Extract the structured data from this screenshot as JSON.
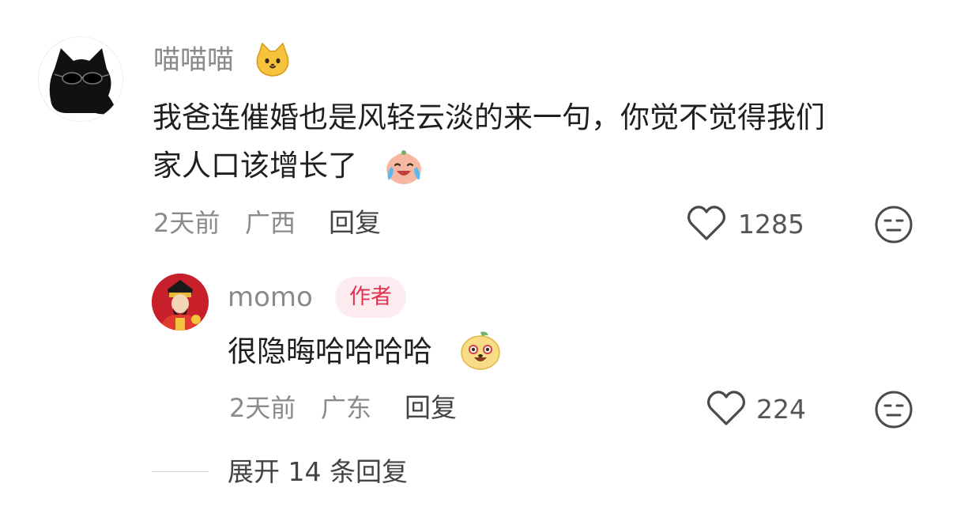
{
  "comment": {
    "username": "喵喵喵",
    "username_emoji": "cat-face-emoji",
    "text_line1": "我爸连催婚也是风轻云淡的来一句，你觉不觉得我们",
    "text_line2": "家人口该增长了",
    "text_emoji": "laughing-crying-emoji",
    "time": "2天前",
    "location": "广西",
    "reply_label": "回复",
    "likes": "1285"
  },
  "reply": {
    "username": "momo",
    "badge": "作者",
    "text": "很隐晦哈哈哈哈",
    "text_emoji": "grinning-sticker-emoji",
    "time": "2天前",
    "location": "广东",
    "reply_label": "回复",
    "likes": "224"
  },
  "expand": {
    "label": "展开 14 条回复"
  },
  "colors": {
    "badge_text": "#e3324f",
    "badge_bg": "#fdecef",
    "meta_gray": "#8a8a8a"
  }
}
